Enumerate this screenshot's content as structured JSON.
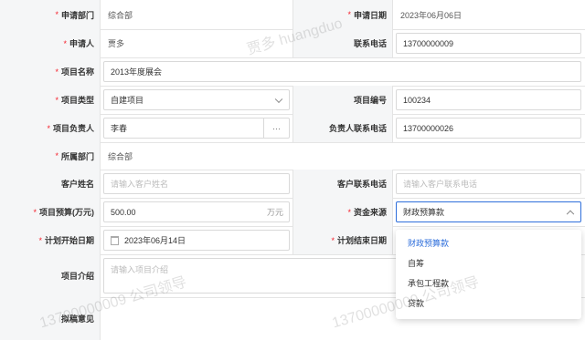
{
  "fields": {
    "dept": {
      "label": "申请部门",
      "value": "综合部"
    },
    "apply_date": {
      "label": "申请日期",
      "value": "2023年06月06日"
    },
    "applicant": {
      "label": "申请人",
      "value": "贾多"
    },
    "phone": {
      "label": "联系电话",
      "value": "13700000009"
    },
    "project_name": {
      "label": "项目名称",
      "value": "2013年度展会"
    },
    "project_type": {
      "label": "项目类型",
      "value": "自建项目"
    },
    "project_no": {
      "label": "项目编号",
      "value": "100234"
    },
    "owner": {
      "label": "项目负责人",
      "value": "李春",
      "button": "···"
    },
    "owner_phone": {
      "label": "负责人联系电话",
      "value": "13700000026"
    },
    "owner_dept": {
      "label": "所属部门",
      "value": "综合部"
    },
    "customer": {
      "label": "客户姓名",
      "placeholder": "请输入客户姓名"
    },
    "customer_phone": {
      "label": "客户联系电话",
      "placeholder": "请输入客户联系电话"
    },
    "budget": {
      "label": "项目预算(万元)",
      "value": "500.00",
      "unit": "万元"
    },
    "fund_source": {
      "label": "资金来源",
      "value": "财政预算款"
    },
    "start_date": {
      "label": "计划开始日期",
      "value": "2023年06月14日"
    },
    "end_date": {
      "label": "计划结束日期"
    },
    "intro": {
      "label": "项目介绍",
      "placeholder": "请输入项目介绍"
    },
    "opinion": {
      "label": "拟稿意见"
    }
  },
  "fund_options": [
    "财政预算款",
    "自筹",
    "承包工程款",
    "贷款"
  ],
  "selected_option": "财政预算款",
  "watermarks": [
    "贾多 huangduo",
    "13700000009 公司领导",
    "13700000009 公司领导"
  ]
}
